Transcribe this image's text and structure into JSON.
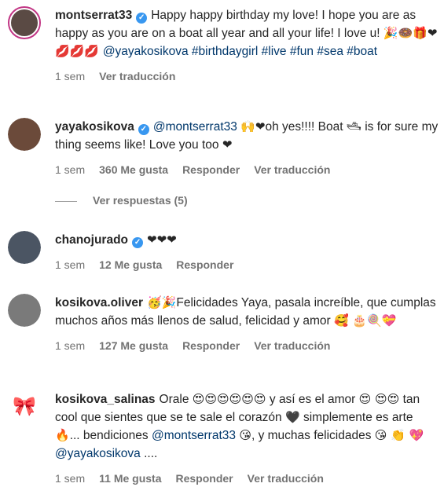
{
  "comments": [
    {
      "user": "montserrat33",
      "verified": true,
      "parts": [
        {
          "t": "text",
          "v": "Happy happy birthday my love! I hope you are as happy as you are on a boat all year and all your life! I love u! "
        },
        {
          "t": "emoji",
          "v": "🎉🍩🎁❤💋💋💋 "
        },
        {
          "t": "tag",
          "v": "@yayakosikova"
        },
        {
          "t": "text",
          "v": " "
        },
        {
          "t": "tag",
          "v": "#birthdaygirl"
        },
        {
          "t": "text",
          "v": " "
        },
        {
          "t": "tag",
          "v": "#live"
        },
        {
          "t": "text",
          "v": " "
        },
        {
          "t": "tag",
          "v": "#fun"
        },
        {
          "t": "text",
          "v": " "
        },
        {
          "t": "tag",
          "v": "#sea"
        },
        {
          "t": "text",
          "v": " "
        },
        {
          "t": "tag",
          "v": "#boat"
        }
      ],
      "time": "1 sem",
      "likes": "",
      "reply": "",
      "translate": "Ver traducción"
    },
    {
      "user": "yayakosikova",
      "verified": true,
      "parts": [
        {
          "t": "tag",
          "v": "@montserrat33"
        },
        {
          "t": "text",
          "v": " "
        },
        {
          "t": "emoji",
          "v": "🙌❤"
        },
        {
          "t": "text",
          "v": "oh yes!!!! Boat "
        },
        {
          "t": "emoji",
          "v": "🛥"
        },
        {
          "t": "text",
          "v": " is for sure my thing seems like! Love you too "
        },
        {
          "t": "emoji",
          "v": "❤"
        }
      ],
      "time": "1 sem",
      "likes": "360 Me gusta",
      "reply": "Responder",
      "translate": "Ver traducción"
    },
    {
      "user": "chanojurado",
      "verified": true,
      "parts": [
        {
          "t": "emoji",
          "v": "❤❤❤"
        }
      ],
      "time": "1 sem",
      "likes": "12 Me gusta",
      "reply": "Responder",
      "translate": ""
    },
    {
      "user": "kosikova.oliver",
      "verified": false,
      "parts": [
        {
          "t": "emoji",
          "v": "🥳🎉"
        },
        {
          "t": "text",
          "v": "Felicidades Yaya, pasala increíble, que cumplas muchos años más llenos de salud, felicidad y amor "
        },
        {
          "t": "emoji",
          "v": "🥰 🎂🍭💝"
        }
      ],
      "time": "1 sem",
      "likes": "127 Me gusta",
      "reply": "Responder",
      "translate": "Ver traducción"
    },
    {
      "user": "kosikova_salinas",
      "verified": false,
      "parts": [
        {
          "t": "text",
          "v": "Orale "
        },
        {
          "t": "emoji",
          "v": "😍😍😍😍😍😍"
        },
        {
          "t": "text",
          "v": " y así es el amor "
        },
        {
          "t": "emoji",
          "v": "😍 😍😍"
        },
        {
          "t": "text",
          "v": " tan cool que sientes que se te sale el corazón "
        },
        {
          "t": "emoji",
          "v": "🖤"
        },
        {
          "t": "text",
          "v": " simplemente es arte "
        },
        {
          "t": "emoji",
          "v": "🔥"
        },
        {
          "t": "text",
          "v": "... bendiciones "
        },
        {
          "t": "tag",
          "v": "@montserrat33"
        },
        {
          "t": "text",
          "v": " "
        },
        {
          "t": "emoji",
          "v": "😘"
        },
        {
          "t": "text",
          "v": ", y muchas felicidades "
        },
        {
          "t": "emoji",
          "v": "😘 👏 💖"
        },
        {
          "t": "text",
          "v": " "
        },
        {
          "t": "tag",
          "v": "@yayakosikova"
        },
        {
          "t": "text",
          "v": " ...."
        }
      ],
      "time": "1 sem",
      "likes": "11 Me gusta",
      "reply": "Responder",
      "translate": "Ver traducción"
    }
  ],
  "view_replies": "Ver respuestas (5)",
  "avatars": [
    {
      "icon": "profile-photo-icon",
      "color": "#5a4a44",
      "ring": true
    },
    {
      "icon": "profile-photo-icon",
      "color": "#6b4a3a",
      "ring": false
    },
    {
      "icon": "profile-photo-icon",
      "color": "#4b5563",
      "ring": false
    },
    {
      "icon": "profile-photo-icon",
      "color": "#7a7a7a",
      "ring": false
    },
    {
      "icon": "bow-icon",
      "color": "#ffffff",
      "ring": false
    }
  ]
}
